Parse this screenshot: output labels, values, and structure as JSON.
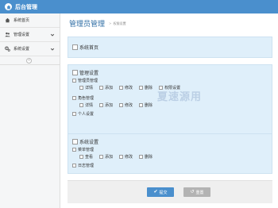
{
  "app": {
    "title": "后台管理"
  },
  "sidebar": {
    "items": [
      {
        "label": "系统首页"
      },
      {
        "label": "管理设置"
      },
      {
        "label": "系统设置"
      }
    ],
    "collapse_symbol": "«"
  },
  "header": {
    "title": "管理员管理",
    "breadcrumb_arrow": ">",
    "breadcrumb": "权限设置"
  },
  "permissions": {
    "home": {
      "label": "系统首页"
    },
    "management": {
      "label": "管理设置",
      "admin_group": {
        "label": "管理员管理",
        "actions": [
          "详情",
          "添加",
          "修改",
          "删除",
          "权限设置"
        ]
      },
      "role_group": {
        "label": "角色管理",
        "actions": [
          "详情",
          "添加",
          "修改",
          "删除"
        ]
      },
      "personal": {
        "label": "个人设置"
      }
    },
    "system": {
      "label": "系统设置",
      "menu_group": {
        "label": "菜单管理",
        "actions": [
          "查看",
          "添加",
          "修改",
          "删除"
        ]
      },
      "log": {
        "label": "日志管理"
      }
    }
  },
  "footer": {
    "submit_label": "提交",
    "reset_label": "重置"
  },
  "watermark": {
    "text": "夏速源用"
  },
  "colors": {
    "accent": "#4a8fcd",
    "panel": "#dfeffa",
    "reset": "#b3b3b3"
  }
}
